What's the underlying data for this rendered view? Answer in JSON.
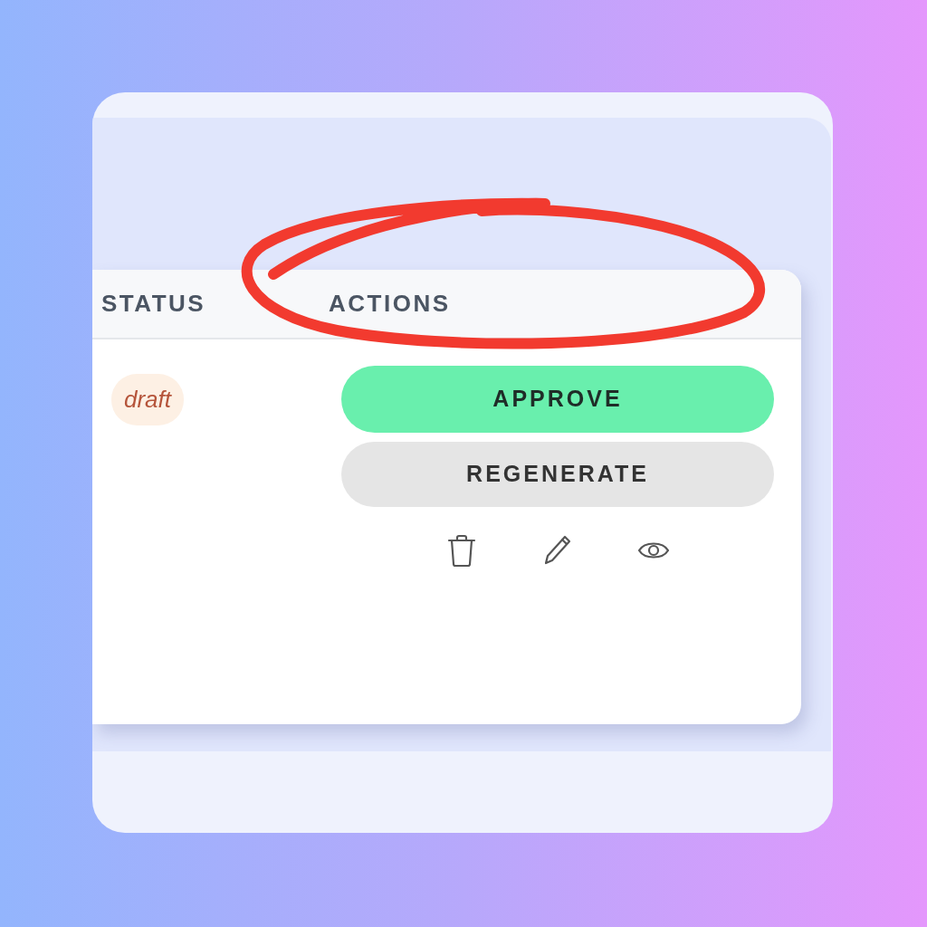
{
  "table": {
    "columns": [
      "STATUS",
      "ACTIONS"
    ],
    "rows": [
      {
        "status": "draft",
        "actions": [
          {
            "label": "APPROVE",
            "kind": "primary"
          },
          {
            "label": "REGENERATE",
            "kind": "secondary"
          }
        ]
      }
    ]
  }
}
